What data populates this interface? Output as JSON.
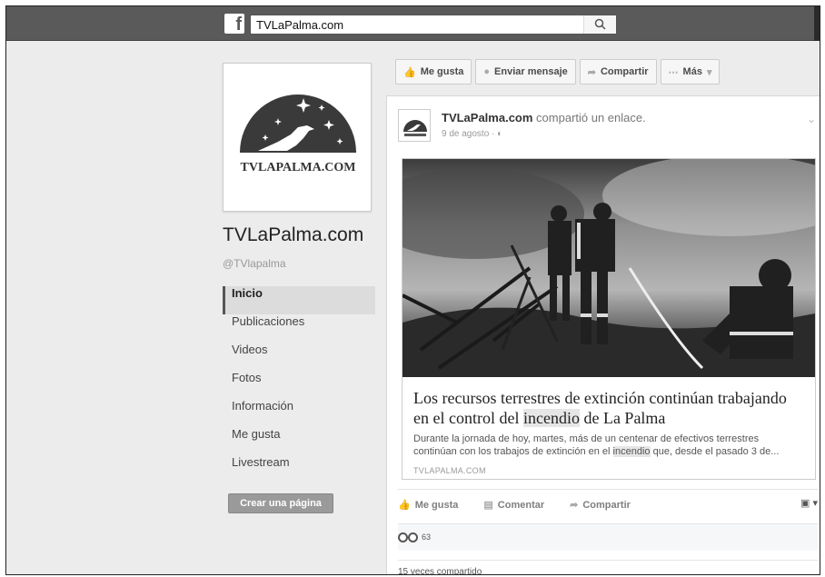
{
  "topbar": {
    "logo_letter": "f",
    "search_value": "TVLaPalma.com"
  },
  "profile": {
    "logo_text": "TVLAPALMA.COM",
    "name": "TVLaPalma.com",
    "handle": "@TVlapalma"
  },
  "nav": {
    "items": [
      {
        "label": "Inicio",
        "active": true
      },
      {
        "label": "Publicaciones"
      },
      {
        "label": "Videos"
      },
      {
        "label": "Fotos"
      },
      {
        "label": "Información"
      },
      {
        "label": "Me gusta"
      },
      {
        "label": "Livestream"
      }
    ],
    "create_page_label": "Crear una página"
  },
  "action_bar": {
    "like": "Me gusta",
    "message": "Enviar mensaje",
    "share": "Compartir",
    "more": "Más"
  },
  "post": {
    "author": "TVLaPalma.com",
    "action_text": " compartió un enlace.",
    "date": "9 de agosto · ",
    "card": {
      "title_part1": "Los recursos terrestres de extinción continúan trabajando en el control del ",
      "title_highlight": "incendio",
      "title_part2": " de La Palma",
      "desc_part1": "Durante la jornada de hoy, martes, más de un centenar de efectivos terrestres continúan con los trabajos de extinción en el ",
      "desc_highlight": "incendio",
      "desc_part2": " que, desde el pasado 3 de...",
      "domain": "TVLAPALMA.COM"
    },
    "actions": {
      "like": "Me gusta",
      "comment": "Comentar",
      "share": "Compartir"
    },
    "reaction_count": "63",
    "shares_text": "15 veces compartido"
  }
}
